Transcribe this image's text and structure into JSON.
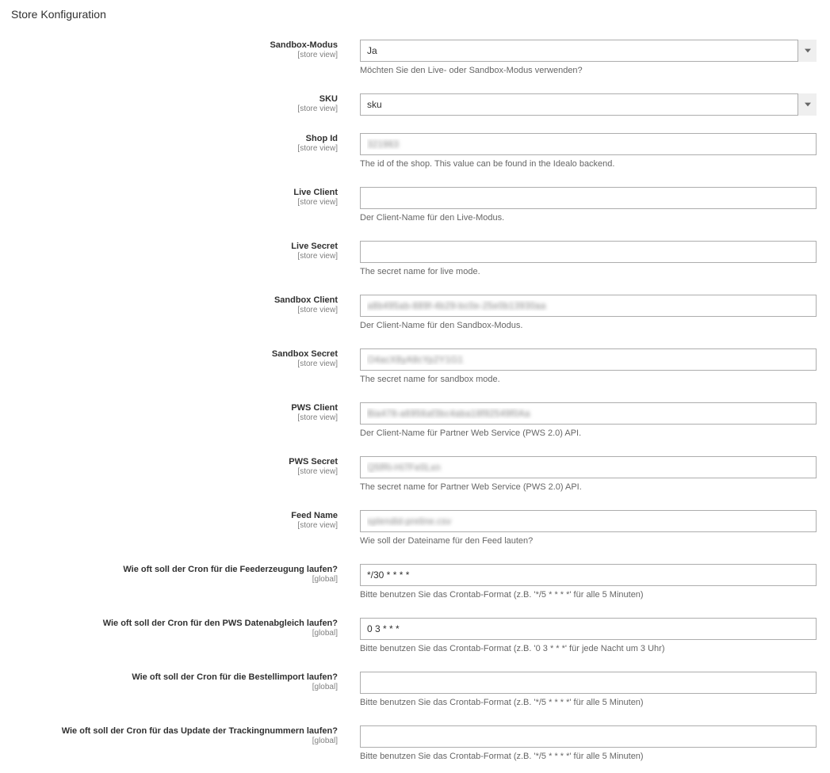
{
  "section_title": "Store Konfiguration",
  "scope_store": "[store view]",
  "scope_global": "[global]",
  "fields": {
    "sandbox_mode": {
      "label": "Sandbox-Modus",
      "value": "Ja",
      "note": "Möchten Sie den Live- oder Sandbox-Modus verwenden?"
    },
    "sku": {
      "label": "SKU",
      "value": "sku"
    },
    "shop_id": {
      "label": "Shop Id",
      "value": "321963",
      "note": "The id of the shop. This value can be found in the Idealo backend."
    },
    "live_client": {
      "label": "Live Client",
      "value": "",
      "note": "Der Client-Name für den Live-Modus."
    },
    "live_secret": {
      "label": "Live Secret",
      "value": "",
      "note": "The secret name for live mode."
    },
    "sandbox_client": {
      "label": "Sandbox Client",
      "value": "a8b495ab-889f-4b29-bc0e-25e0b13930aa",
      "note": "Der Client-Name für den Sandbox-Modus."
    },
    "sandbox_secret": {
      "label": "Sandbox Secret",
      "value": "O4acX8yA8cYp2Y1G1",
      "note": "The secret name for sandbox mode."
    },
    "pws_client": {
      "label": "PWS Client",
      "value": "Bia478-a6956af3bc4aba18f92549f0Aa",
      "note": "Der Client-Name für Partner Web Service (PWS 2.0) API."
    },
    "pws_secret": {
      "label": "PWS Secret",
      "value": "Q5fRi-Hi7Fe0Lxn",
      "note": "The secret name for Partner Web Service (PWS 2.0) API."
    },
    "feed_name": {
      "label": "Feed Name",
      "value": "splendid-preline.csv",
      "note": "Wie soll der Dateiname für den Feed lauten?"
    },
    "cron_feed": {
      "label": "Wie oft soll der Cron für die Feederzeugung laufen?",
      "value": "*/30 * * * *",
      "note": "Bitte benutzen Sie das Crontab-Format (z.B. '*/5 * * * *' für alle 5 Minuten)"
    },
    "cron_pws": {
      "label": "Wie oft soll der Cron für den PWS Datenabgleich laufen?",
      "value": "0 3 * * *",
      "note": "Bitte benutzen Sie das Crontab-Format (z.B. '0 3 * * *' für jede Nacht um 3 Uhr)"
    },
    "cron_order": {
      "label": "Wie oft soll der Cron für die Bestellimport laufen?",
      "value": "",
      "note": "Bitte benutzen Sie das Crontab-Format (z.B. '*/5 * * * *' für alle 5 Minuten)"
    },
    "cron_tracking": {
      "label": "Wie oft soll der Cron für das Update der Trackingnummern laufen?",
      "value": "",
      "note": "Bitte benutzen Sie das Crontab-Format (z.B. '*/5 * * * *' für alle 5 Minuten)"
    }
  }
}
